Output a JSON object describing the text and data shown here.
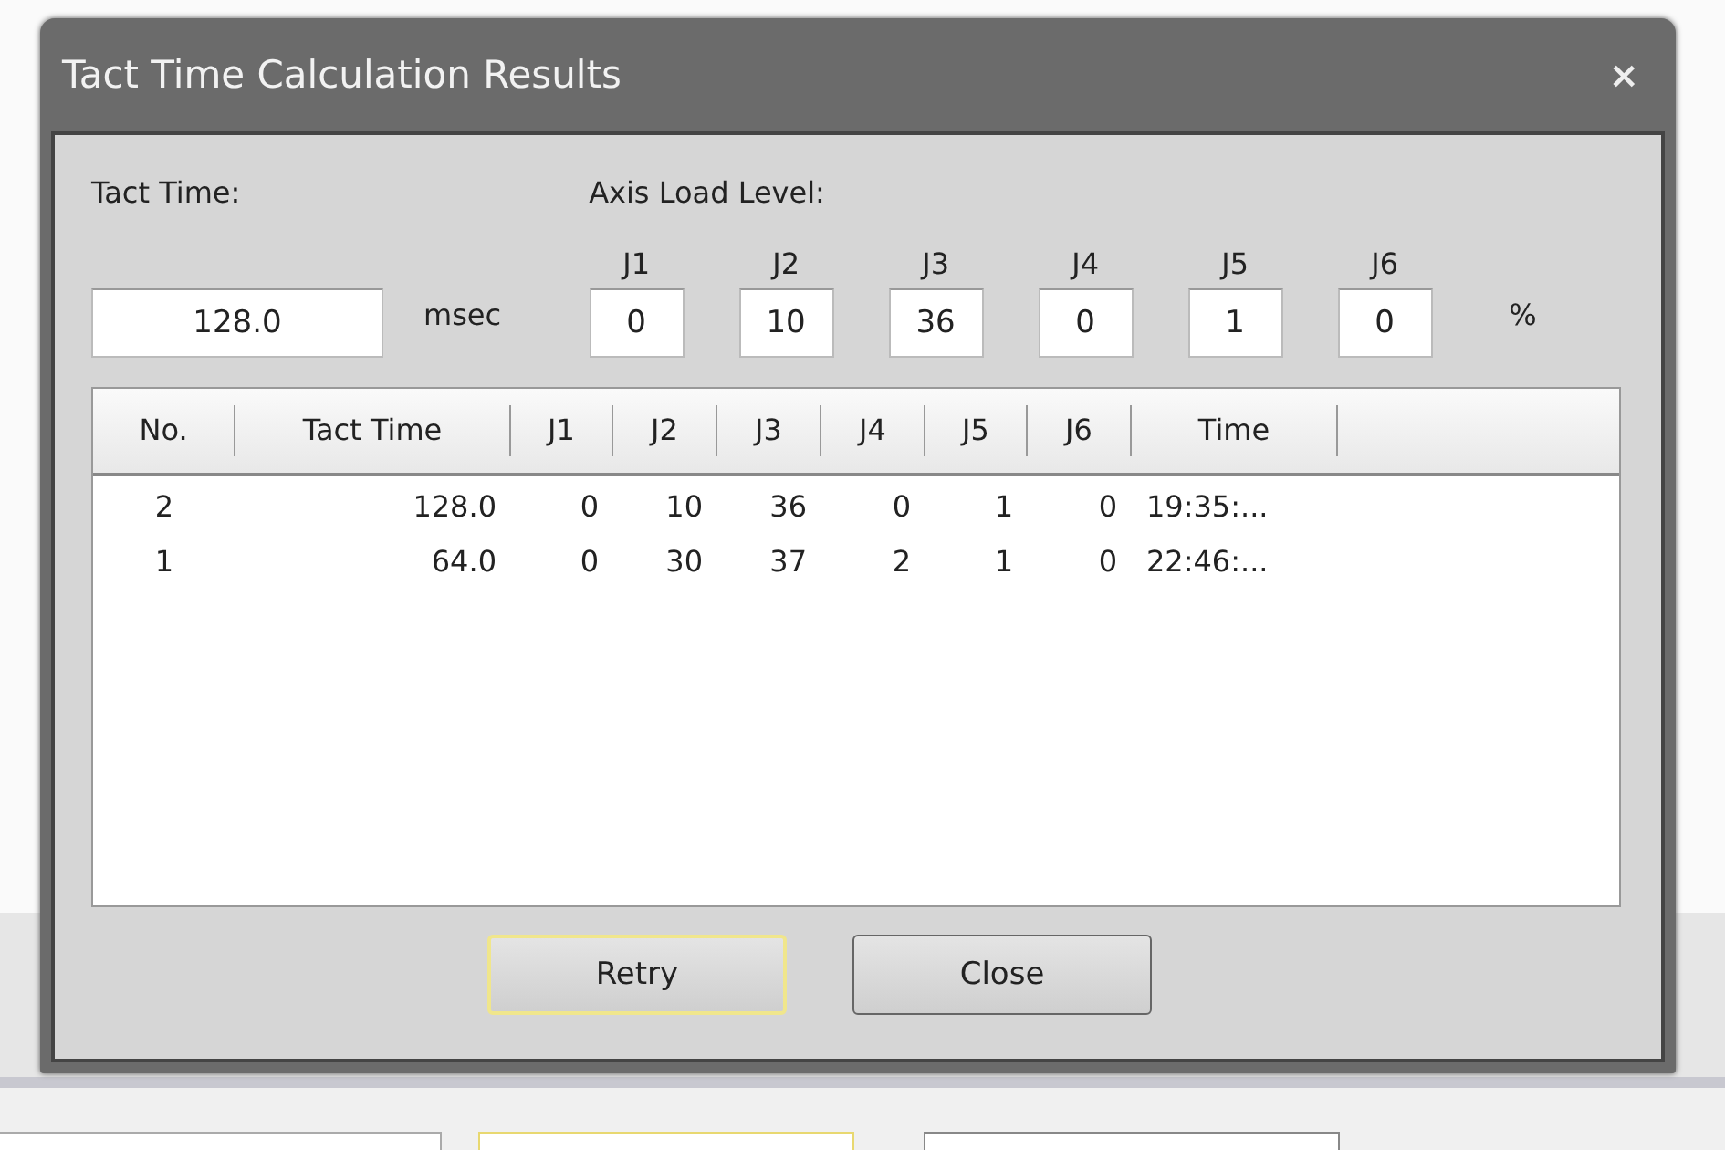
{
  "window": {
    "title": "Tact Time Calculation Results",
    "close": "×"
  },
  "tact_time": {
    "label": "Tact Time:",
    "value": "128.0",
    "unit": "msec"
  },
  "axis_load": {
    "label": "Axis Load Level:",
    "unit": "%",
    "axes": [
      {
        "name": "J1",
        "value": "0"
      },
      {
        "name": "J2",
        "value": "10"
      },
      {
        "name": "J3",
        "value": "36"
      },
      {
        "name": "J4",
        "value": "0"
      },
      {
        "name": "J5",
        "value": "1"
      },
      {
        "name": "J6",
        "value": "0"
      }
    ]
  },
  "table": {
    "columns": [
      "No.",
      "Tact Time",
      "J1",
      "J2",
      "J3",
      "J4",
      "J5",
      "J6",
      "Time"
    ],
    "rows": [
      [
        "2",
        "128.0",
        "0",
        "10",
        "36",
        "0",
        "1",
        "0",
        "19:35:..."
      ],
      [
        "1",
        "64.0",
        "0",
        "30",
        "37",
        "2",
        "1",
        "0",
        "22:46:..."
      ]
    ]
  },
  "buttons": [
    {
      "label": "Retry",
      "focused": true
    },
    {
      "label": "Close",
      "focused": false
    }
  ]
}
